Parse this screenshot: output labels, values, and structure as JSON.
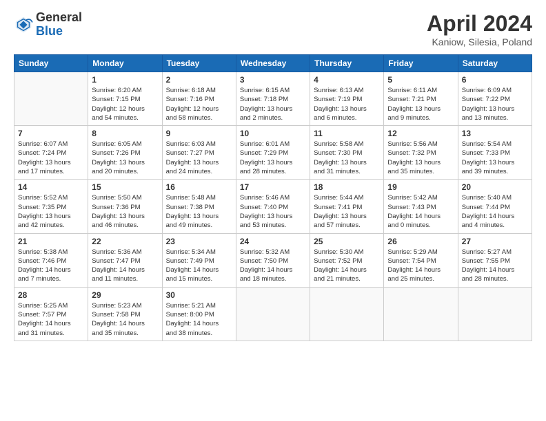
{
  "header": {
    "logo_general": "General",
    "logo_blue": "Blue",
    "title": "April 2024",
    "subtitle": "Kaniow, Silesia, Poland"
  },
  "weekdays": [
    "Sunday",
    "Monday",
    "Tuesday",
    "Wednesday",
    "Thursday",
    "Friday",
    "Saturday"
  ],
  "weeks": [
    [
      {
        "day": "",
        "info": ""
      },
      {
        "day": "1",
        "info": "Sunrise: 6:20 AM\nSunset: 7:15 PM\nDaylight: 12 hours\nand 54 minutes."
      },
      {
        "day": "2",
        "info": "Sunrise: 6:18 AM\nSunset: 7:16 PM\nDaylight: 12 hours\nand 58 minutes."
      },
      {
        "day": "3",
        "info": "Sunrise: 6:15 AM\nSunset: 7:18 PM\nDaylight: 13 hours\nand 2 minutes."
      },
      {
        "day": "4",
        "info": "Sunrise: 6:13 AM\nSunset: 7:19 PM\nDaylight: 13 hours\nand 6 minutes."
      },
      {
        "day": "5",
        "info": "Sunrise: 6:11 AM\nSunset: 7:21 PM\nDaylight: 13 hours\nand 9 minutes."
      },
      {
        "day": "6",
        "info": "Sunrise: 6:09 AM\nSunset: 7:22 PM\nDaylight: 13 hours\nand 13 minutes."
      }
    ],
    [
      {
        "day": "7",
        "info": "Sunrise: 6:07 AM\nSunset: 7:24 PM\nDaylight: 13 hours\nand 17 minutes."
      },
      {
        "day": "8",
        "info": "Sunrise: 6:05 AM\nSunset: 7:26 PM\nDaylight: 13 hours\nand 20 minutes."
      },
      {
        "day": "9",
        "info": "Sunrise: 6:03 AM\nSunset: 7:27 PM\nDaylight: 13 hours\nand 24 minutes."
      },
      {
        "day": "10",
        "info": "Sunrise: 6:01 AM\nSunset: 7:29 PM\nDaylight: 13 hours\nand 28 minutes."
      },
      {
        "day": "11",
        "info": "Sunrise: 5:58 AM\nSunset: 7:30 PM\nDaylight: 13 hours\nand 31 minutes."
      },
      {
        "day": "12",
        "info": "Sunrise: 5:56 AM\nSunset: 7:32 PM\nDaylight: 13 hours\nand 35 minutes."
      },
      {
        "day": "13",
        "info": "Sunrise: 5:54 AM\nSunset: 7:33 PM\nDaylight: 13 hours\nand 39 minutes."
      }
    ],
    [
      {
        "day": "14",
        "info": "Sunrise: 5:52 AM\nSunset: 7:35 PM\nDaylight: 13 hours\nand 42 minutes."
      },
      {
        "day": "15",
        "info": "Sunrise: 5:50 AM\nSunset: 7:36 PM\nDaylight: 13 hours\nand 46 minutes."
      },
      {
        "day": "16",
        "info": "Sunrise: 5:48 AM\nSunset: 7:38 PM\nDaylight: 13 hours\nand 49 minutes."
      },
      {
        "day": "17",
        "info": "Sunrise: 5:46 AM\nSunset: 7:40 PM\nDaylight: 13 hours\nand 53 minutes."
      },
      {
        "day": "18",
        "info": "Sunrise: 5:44 AM\nSunset: 7:41 PM\nDaylight: 13 hours\nand 57 minutes."
      },
      {
        "day": "19",
        "info": "Sunrise: 5:42 AM\nSunset: 7:43 PM\nDaylight: 14 hours\nand 0 minutes."
      },
      {
        "day": "20",
        "info": "Sunrise: 5:40 AM\nSunset: 7:44 PM\nDaylight: 14 hours\nand 4 minutes."
      }
    ],
    [
      {
        "day": "21",
        "info": "Sunrise: 5:38 AM\nSunset: 7:46 PM\nDaylight: 14 hours\nand 7 minutes."
      },
      {
        "day": "22",
        "info": "Sunrise: 5:36 AM\nSunset: 7:47 PM\nDaylight: 14 hours\nand 11 minutes."
      },
      {
        "day": "23",
        "info": "Sunrise: 5:34 AM\nSunset: 7:49 PM\nDaylight: 14 hours\nand 15 minutes."
      },
      {
        "day": "24",
        "info": "Sunrise: 5:32 AM\nSunset: 7:50 PM\nDaylight: 14 hours\nand 18 minutes."
      },
      {
        "day": "25",
        "info": "Sunrise: 5:30 AM\nSunset: 7:52 PM\nDaylight: 14 hours\nand 21 minutes."
      },
      {
        "day": "26",
        "info": "Sunrise: 5:29 AM\nSunset: 7:54 PM\nDaylight: 14 hours\nand 25 minutes."
      },
      {
        "day": "27",
        "info": "Sunrise: 5:27 AM\nSunset: 7:55 PM\nDaylight: 14 hours\nand 28 minutes."
      }
    ],
    [
      {
        "day": "28",
        "info": "Sunrise: 5:25 AM\nSunset: 7:57 PM\nDaylight: 14 hours\nand 31 minutes."
      },
      {
        "day": "29",
        "info": "Sunrise: 5:23 AM\nSunset: 7:58 PM\nDaylight: 14 hours\nand 35 minutes."
      },
      {
        "day": "30",
        "info": "Sunrise: 5:21 AM\nSunset: 8:00 PM\nDaylight: 14 hours\nand 38 minutes."
      },
      {
        "day": "",
        "info": ""
      },
      {
        "day": "",
        "info": ""
      },
      {
        "day": "",
        "info": ""
      },
      {
        "day": "",
        "info": ""
      }
    ]
  ]
}
